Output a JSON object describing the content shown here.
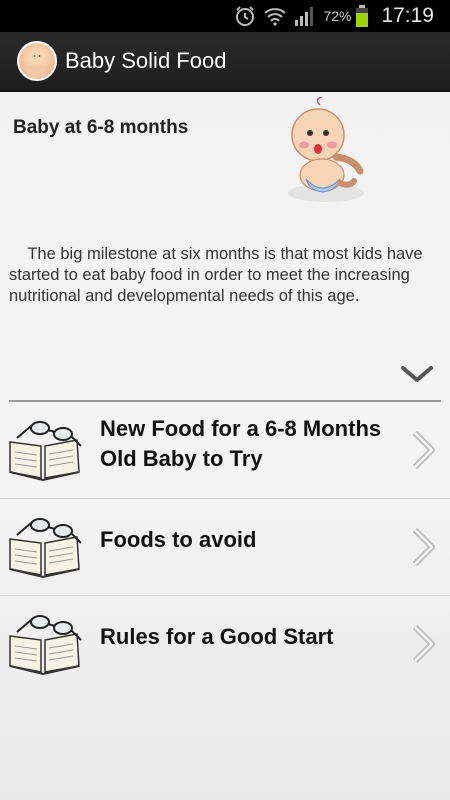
{
  "status_bar": {
    "battery_percent": "72%",
    "time": "17:19",
    "icons": [
      "alarm-icon",
      "wifi-icon",
      "signal-icon",
      "battery-icon"
    ]
  },
  "action_bar": {
    "title": "Baby Solid Food",
    "icon": "baby-app-icon"
  },
  "header": {
    "title": "Baby at 6-8 months",
    "intro": "The big milestone at six months is that most kids have started to eat baby food in order to meet the increasing nutritional and developmental needs of this age."
  },
  "menu": [
    {
      "label": "New Food for a 6-8 Months Old Baby to Try",
      "icon": "book-glasses-icon"
    },
    {
      "label": "Foods to avoid",
      "icon": "book-glasses-icon"
    },
    {
      "label": "Rules for a Good Start",
      "icon": "book-glasses-icon"
    }
  ],
  "colors": {
    "status_bar": "#000000",
    "action_bar": "#232323",
    "background": "#f2f2f2",
    "battery": "#9bd200"
  }
}
